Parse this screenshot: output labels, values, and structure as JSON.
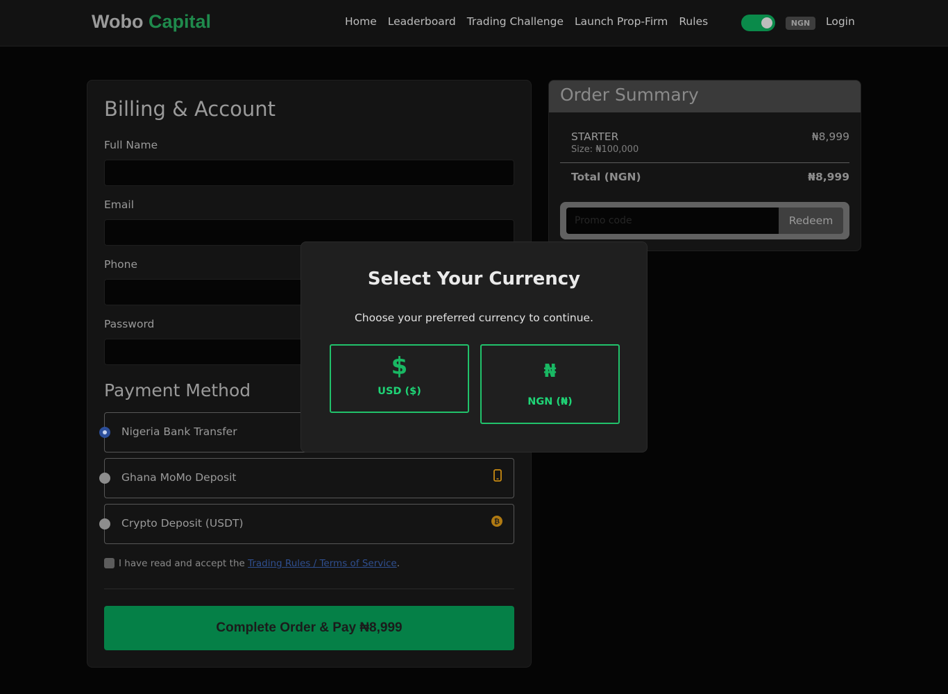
{
  "nav": {
    "brand_main": "Wobo",
    "brand_accent": "Capital",
    "links": [
      "Home",
      "Leaderboard",
      "Trading Challenge",
      "Launch Prop-Firm",
      "Rules"
    ],
    "currency_badge": "NGN",
    "login": "Login",
    "toggle_on": true
  },
  "billing": {
    "title": "Billing & Account",
    "full_name_label": "Full Name",
    "email_label": "Email",
    "phone_label": "Phone",
    "password_label": "Password"
  },
  "payment": {
    "title": "Payment Method",
    "options": [
      {
        "label": "Nigeria Bank Transfer",
        "selected": true,
        "icon": ""
      },
      {
        "label": "Ghana MoMo Deposit",
        "selected": false,
        "icon": "mobile-icon"
      },
      {
        "label": "Crypto Deposit (USDT)",
        "selected": false,
        "icon": "bitcoin-icon"
      }
    ],
    "terms_prefix": "I have read and accept the ",
    "terms_link": "Trading Rules / Terms of Service",
    "terms_suffix": ".",
    "pay_button": "Complete Order & Pay ₦8,999"
  },
  "summary": {
    "title": "Order Summary",
    "plan": "STARTER",
    "size": "Size: ₦100,000",
    "price": "₦8,999",
    "total_label": "Total (NGN)",
    "total_value": "₦8,999",
    "promo_placeholder": "Promo code",
    "redeem": "Redeem"
  },
  "modal": {
    "title": "Select Your Currency",
    "subtitle": "Choose your preferred currency to continue.",
    "usd_symbol": "$",
    "usd_label": "USD ($)",
    "ngn_symbol": "₦",
    "ngn_label": "NGN (₦)"
  },
  "colors": {
    "accent_green": "#058047",
    "modal_border_green": "#21c26b",
    "link_blue": "#2f4f8f"
  }
}
